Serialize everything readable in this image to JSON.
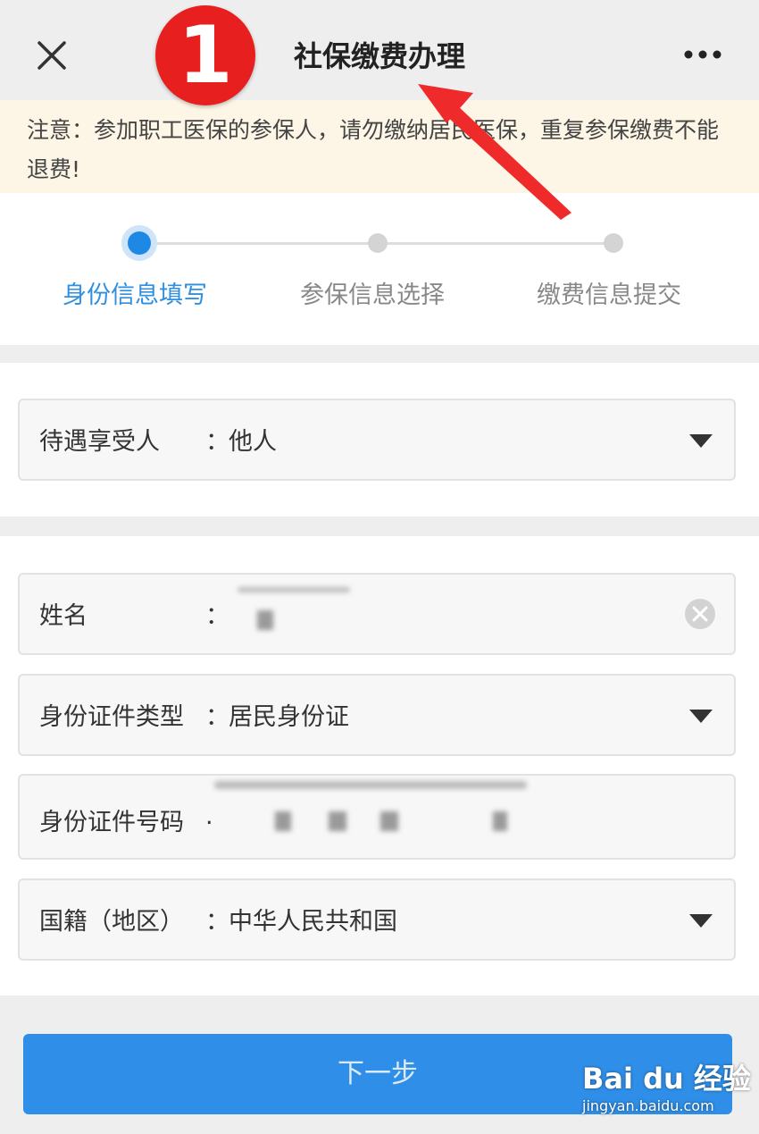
{
  "header": {
    "title": "社保缴费办理",
    "close_icon": "close-icon",
    "more_icon": "more-icon"
  },
  "annotation": {
    "step_number": "1",
    "badge_color": "#e81f1f"
  },
  "notice": {
    "text": "注意：参加职工医保的参保人，请勿缴纳居民医保，重复参保缴费不能退费!"
  },
  "steps": [
    {
      "label": "身份信息填写",
      "state": "active"
    },
    {
      "label": "参保信息选择",
      "state": "pending"
    },
    {
      "label": "缴费信息提交",
      "state": "pending"
    }
  ],
  "form": {
    "beneficiary": {
      "label": "待遇享受人",
      "colon": "：",
      "value": "他人"
    },
    "name": {
      "label": "姓名",
      "colon": "："
    },
    "id_type": {
      "label": "身份证件类型",
      "colon": "：",
      "value": "居民身份证"
    },
    "id_number": {
      "label": "身份证件号码",
      "colon": "."
    },
    "nationality": {
      "label": "国籍（地区）",
      "colon": "：",
      "value": "中华人民共和国"
    }
  },
  "actions": {
    "next_label": "下一步"
  },
  "watermark": {
    "logo": "Bai du 经验",
    "url": "jingyan.baidu.com"
  },
  "colors": {
    "accent": "#1e88e5",
    "button": "#2f8fe8",
    "notice_bg": "#fdf6e6"
  }
}
